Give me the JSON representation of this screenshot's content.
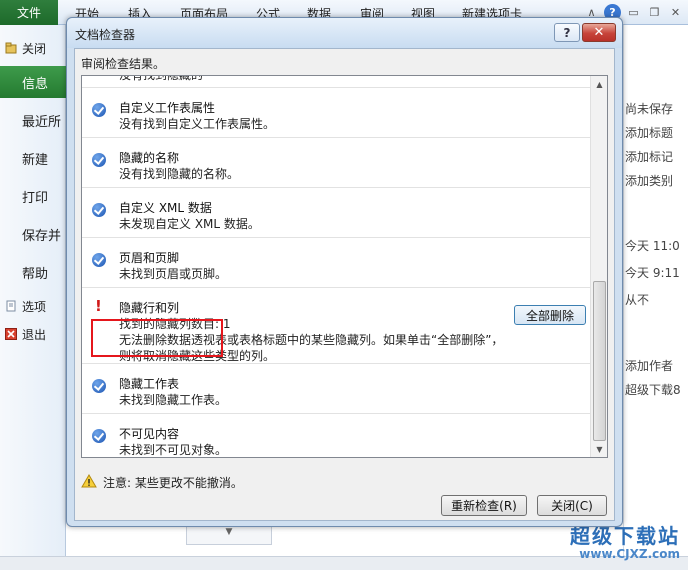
{
  "ribbon": {
    "file_tab": "文件",
    "tabs": [
      "开始",
      "插入",
      "页面布局",
      "公式",
      "数据",
      "审阅",
      "视图",
      "新建选项卡"
    ]
  },
  "backstage": {
    "close_item": "关闭",
    "items": [
      {
        "label": "信息",
        "active": true
      },
      {
        "label": "最近所"
      },
      {
        "label": "新建"
      },
      {
        "label": "打印"
      },
      {
        "label": "保存并"
      },
      {
        "label": "帮助"
      }
    ],
    "options_item": "选项",
    "exit_item": "退出"
  },
  "right_panel": {
    "lines": [
      "尚未保存",
      "添加标题",
      "添加标记",
      "添加类别",
      "今天 11:0",
      "今天 9:11",
      "从不",
      "添加作者",
      "超级下载8"
    ]
  },
  "dialog": {
    "title": "文档检查器",
    "help_label": "?",
    "close_label": "✕",
    "review_label": "审阅检查结果。",
    "cut_item_text": "没有找到隐藏的",
    "items": [
      {
        "title": "自定义工作表属性",
        "desc": "没有找到自定义工作表属性。",
        "status": "ok"
      },
      {
        "title": "隐藏的名称",
        "desc": "没有找到隐藏的名称。",
        "status": "ok"
      },
      {
        "title": "自定义 XML 数据",
        "desc": "未发现自定义 XML 数据。",
        "status": "ok"
      },
      {
        "title": "页眉和页脚",
        "desc": "未找到页眉或页脚。",
        "status": "ok"
      },
      {
        "title": "隐藏行和列",
        "desc": "找到的隐藏列数目: 1",
        "desc2": "无法删除数据透视表或表格标题中的某些隐藏列。如果单击“全部删除”，则将取消隐藏这些类型的列。",
        "status": "warning",
        "action": "全部删除"
      },
      {
        "title": "隐藏工作表",
        "desc": "未找到隐藏工作表。",
        "status": "ok"
      },
      {
        "title": "不可见内容",
        "desc": "未找到不可见对象。",
        "status": "ok"
      }
    ],
    "note": "注意: 某些更改不能撤消。",
    "recheck_button": "重新检查(R)",
    "close_button": "关闭(C)"
  },
  "watermark": {
    "line1": "超级下载站",
    "line2": "www.CJXZ.com"
  },
  "colors": {
    "file_tab": "#1d6a2a",
    "active_item": "#2e8a3c",
    "highlight": "#e5161c",
    "check_icon": "#1d56b3"
  }
}
